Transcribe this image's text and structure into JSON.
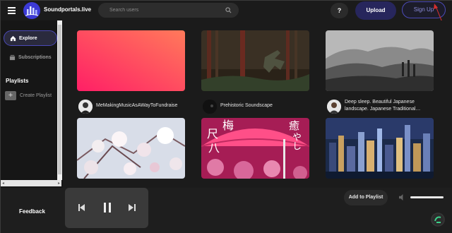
{
  "header": {
    "site_name": "Soundportals.live",
    "search_placeholder": "Search users",
    "help_label": "?",
    "upload_label": "Upload",
    "signup_label": "Sign Up"
  },
  "sidebar": {
    "items": [
      {
        "label": "Explore",
        "icon": "home-icon",
        "active": true
      },
      {
        "label": "Subscriptions",
        "icon": "subscriptions-icon",
        "active": false
      }
    ],
    "playlists_heading": "Playlists",
    "create_playlist_label": "Create Playlist",
    "create_playlist_icon": "+"
  },
  "cards": [
    {
      "title": "MeMakingMusicAsAWayToFundraise",
      "thumbnail": "pink-gradient",
      "avatar": "person-avatar"
    },
    {
      "title": "Prehistoric Soundscape",
      "thumbnail": "dinosaur-forest",
      "avatar": "dark-avatar"
    },
    {
      "title": "Deep sleep. Beautiful Japanese landscape. Japanese Traditional…",
      "thumbnail": "misty-mountains",
      "avatar": "person-avatar"
    },
    {
      "title": "",
      "thumbnail": "cherry-blossoms",
      "avatar": ""
    },
    {
      "title": "",
      "thumbnail": "pink-umbrella",
      "avatar": "",
      "kanji_left": "梅",
      "kanji_left2": "尺",
      "kanji_left3": "八",
      "kanji_right": "癒",
      "kanji_right2": "やし"
    },
    {
      "title": "",
      "thumbnail": "city-night",
      "avatar": ""
    }
  ],
  "player": {
    "feedback_label": "Feedback",
    "add_to_playlist_label": "Add to Playlist",
    "volume_level": 1.0
  },
  "colors": {
    "accent": "#4b4ab8",
    "background": "#1b1b1b",
    "annotation_arrow": "#d32f2f"
  }
}
